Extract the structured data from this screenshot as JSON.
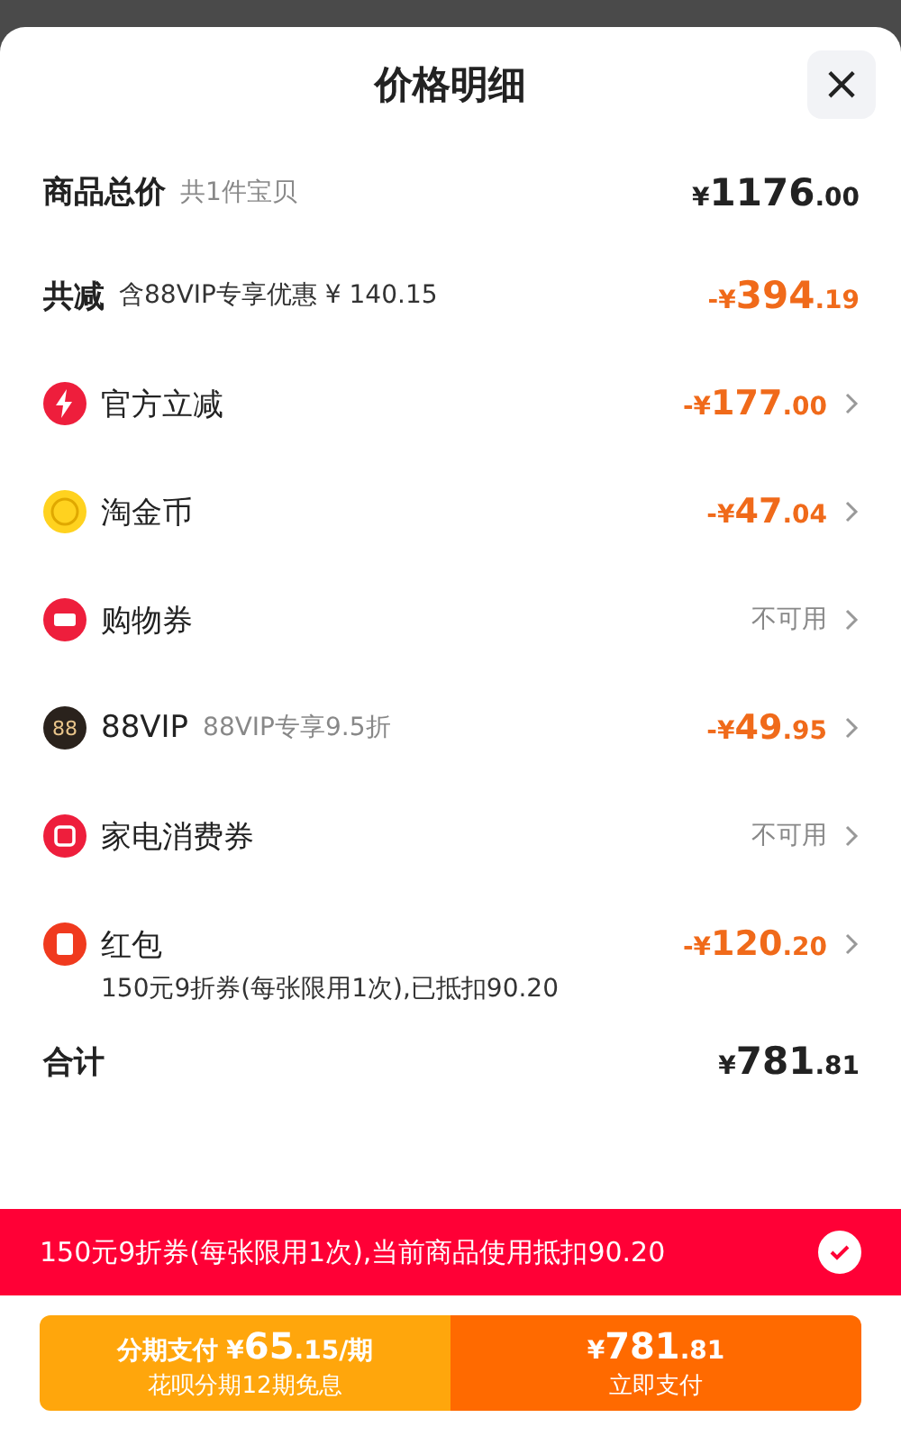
{
  "sheet": {
    "title": "价格明细",
    "close": "×"
  },
  "summary": {
    "label": "商品总价",
    "note": "共1件宝贝",
    "amount": {
      "yen": "¥",
      "int": "1176",
      "dec": ".00"
    }
  },
  "reduction": {
    "label": "共减",
    "note": "含88VIP专享优惠 ¥ 140.15",
    "amount": {
      "sign": "-",
      "yen": "¥",
      "int": "394",
      "dec": ".19"
    }
  },
  "items": [
    {
      "kind": "bolt",
      "label": "官方立减",
      "amount": {
        "sign": "-",
        "yen": "¥",
        "int": "177",
        "dec": ".00"
      }
    },
    {
      "kind": "coin",
      "label": "淘金币",
      "amount": {
        "sign": "-",
        "yen": "¥",
        "int": "47",
        "dec": ".04"
      }
    },
    {
      "kind": "ticket",
      "label": "购物券",
      "status": "不可用"
    },
    {
      "kind": "vip",
      "label": "88VIP",
      "icon_text": "88",
      "note": "88VIP专享9.5折",
      "amount": {
        "sign": "-",
        "yen": "¥",
        "int": "49",
        "dec": ".95"
      }
    },
    {
      "kind": "voucher",
      "label": "家电消费券",
      "status": "不可用"
    },
    {
      "kind": "packet",
      "label": "红包",
      "sub": "150元9折券(每张限用1次),已抵扣90.20",
      "amount": {
        "sign": "-",
        "yen": "¥",
        "int": "120",
        "dec": ".20"
      }
    }
  ],
  "total": {
    "label": "合计",
    "amount": {
      "yen": "¥",
      "int": "781",
      "dec": ".81"
    }
  },
  "banner": {
    "text": "150元9折券(每张限用1次),当前商品使用抵扣90.20",
    "checked": true
  },
  "pay": {
    "installment": {
      "label": "分期支付",
      "yen": "¥",
      "int": "65",
      "dec": ".15",
      "unit": "/期",
      "sub": "花呗分期12期免息"
    },
    "now": {
      "yen": "¥",
      "int": "781",
      "dec": ".81",
      "label": "立即支付"
    }
  }
}
